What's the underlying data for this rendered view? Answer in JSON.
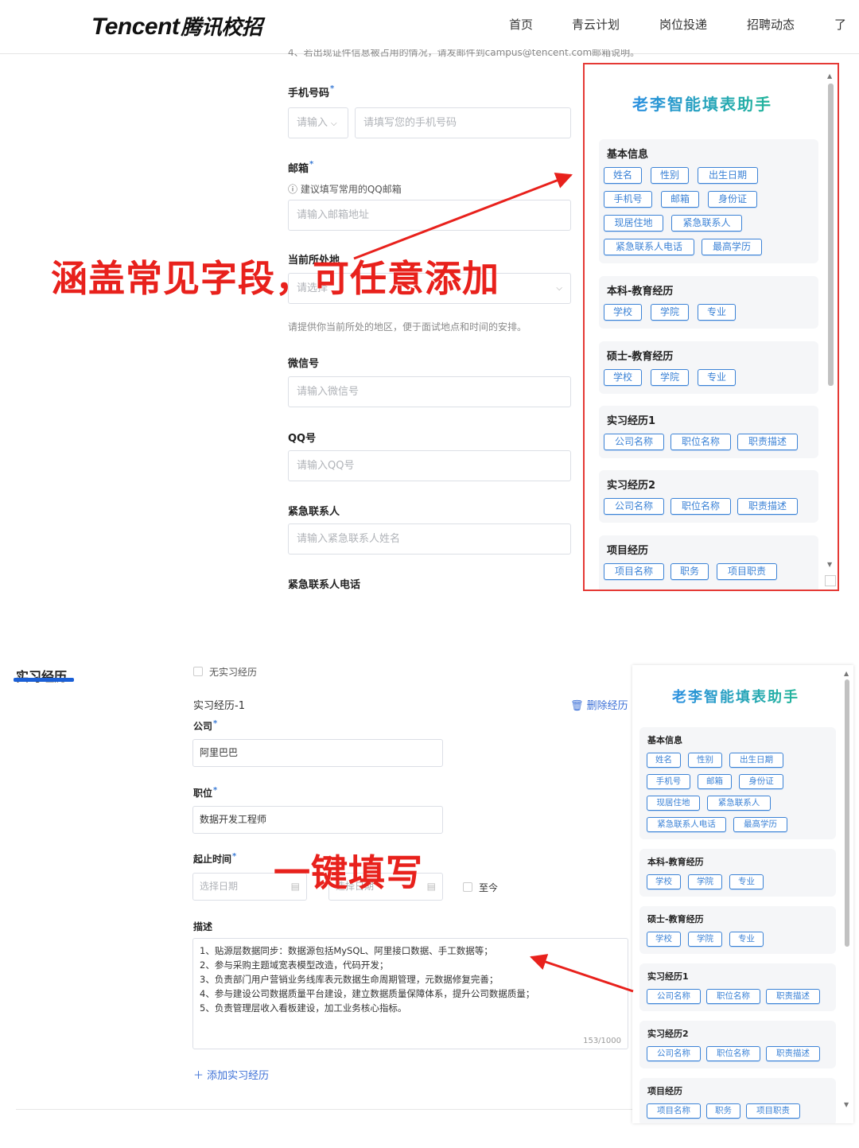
{
  "header": {
    "logo_en": "Tencent",
    "logo_cn": "腾讯校招",
    "nav": [
      "首页",
      "青云计划",
      "岗位投递",
      "招聘动态",
      "了"
    ]
  },
  "upper_form": {
    "cut_text": "4、若出现证件信息被占用的情况，请发邮件到campus@tencent.com邮箱说明。",
    "phone_label": "手机号码",
    "phone_code_placeholder": "请输入",
    "phone_placeholder": "请填写您的手机号码",
    "email_label": "邮箱",
    "email_hint": "建议填写常用的QQ邮箱",
    "email_placeholder": "请输入邮箱地址",
    "location_label": "当前所处地",
    "location_placeholder": "请选择",
    "location_hint": "请提供你当前所处的地区，便于面试地点和时间的安排。",
    "wechat_label": "微信号",
    "wechat_placeholder": "请输入微信号",
    "qq_label": "QQ号",
    "qq_placeholder": "请输入QQ号",
    "emergency_label": "紧急联系人",
    "emergency_placeholder": "请输入紧急联系人姓名",
    "emergency_phone_label": "紧急联系人电话",
    "required_mark": "*"
  },
  "assistant": {
    "title": "老李智能填表助手",
    "sections": [
      {
        "title": "基本信息",
        "chips": [
          "姓名",
          "性别",
          "出生日期",
          "手机号",
          "邮箱",
          "身份证",
          "现居住地",
          "紧急联系人",
          "紧急联系人电话",
          "最高学历"
        ]
      },
      {
        "title": "本科-教育经历",
        "chips": [
          "学校",
          "学院",
          "专业"
        ]
      },
      {
        "title": "硕士-教育经历",
        "chips": [
          "学校",
          "学院",
          "专业"
        ]
      },
      {
        "title": "实习经历1",
        "chips": [
          "公司名称",
          "职位名称",
          "职责描述"
        ]
      },
      {
        "title": "实习经历2",
        "chips": [
          "公司名称",
          "职位名称",
          "职责描述"
        ]
      },
      {
        "title": "项目经历",
        "chips": [
          "项目名称",
          "职务",
          "项目职责"
        ]
      }
    ]
  },
  "annotations": {
    "top_overlay": "涵盖常见字段，可任意添加",
    "bottom_overlay": "一键填写"
  },
  "lower_form": {
    "section_title": "实习经历",
    "no_internship": "无实习经历",
    "entry_title": "实习经历-1",
    "delete_label": "删除经历",
    "company_label": "公司",
    "company_value": "阿里巴巴",
    "position_label": "职位",
    "position_value": "数据开发工程师",
    "period_label": "起止时间",
    "start_placeholder": "选择日期",
    "end_placeholder": "选择日期",
    "dash": "-",
    "until_now": "至今",
    "desc_label": "描述",
    "desc_lines": [
      "1、贴源层数据同步：数据源包括MySQL、阿里接口数据、手工数据等；",
      "2、参与采购主题域宽表模型改造，代码开发；",
      "3、负责部门用户营销业务线库表元数据生命周期管理，元数据修复完善；",
      "4、参与建设公司数据质量平台建设，建立数据质量保障体系，提升公司数据质量；",
      "5、负责管理层收入看板建设，加工业务核心指标。"
    ],
    "char_count": "153/1000",
    "add_label": "添加实习经历",
    "required_mark": "*"
  },
  "colors": {
    "accent_blue": "#3b82d6",
    "annotation_red": "#e8211c",
    "title_gradient_start": "#2a8fe0",
    "title_gradient_end": "#23b59a"
  }
}
